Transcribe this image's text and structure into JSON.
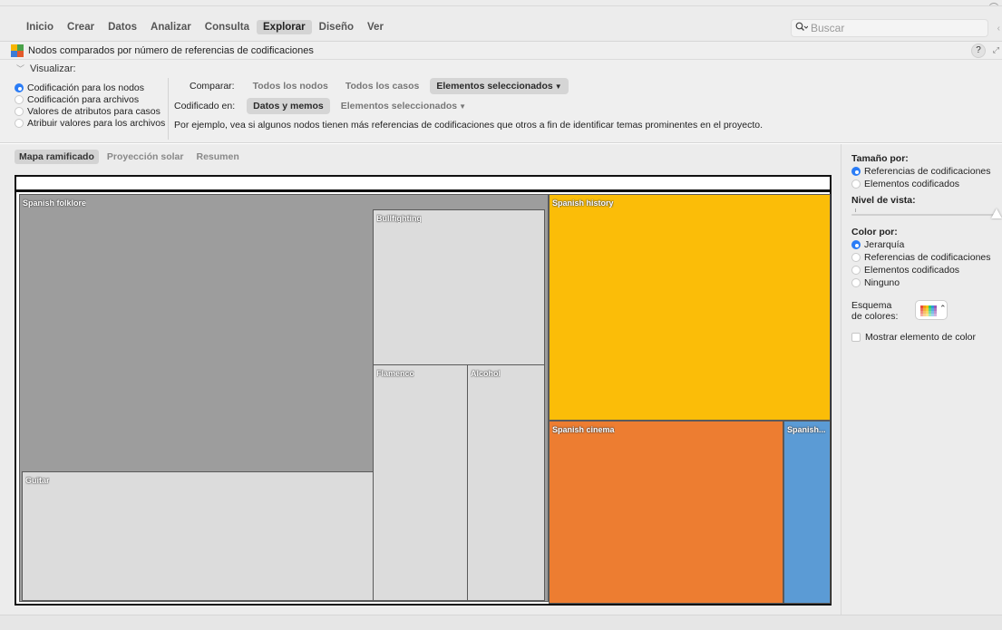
{
  "menu": {
    "items": [
      "Inicio",
      "Crear",
      "Datos",
      "Analizar",
      "Consulta",
      "Explorar",
      "Diseño",
      "Ver"
    ],
    "active_index": 5
  },
  "search": {
    "icon": "search-icon",
    "placeholder": "Buscar"
  },
  "title": {
    "text": "Nodos comparados por número de referencias de codificaciones",
    "help_label": "?"
  },
  "options": {
    "visualize_label": "Visualizar:",
    "visualize_options": [
      {
        "label": "Codificación para los nodos",
        "selected": true
      },
      {
        "label": "Codificación para archivos",
        "selected": false
      },
      {
        "label": "Valores de atributos para casos",
        "selected": false
      },
      {
        "label": "Atribuir valores para los archivos",
        "selected": false
      }
    ],
    "compare_label": "Comparar:",
    "compare_options": [
      "Todos los nodos",
      "Todos los casos",
      "Elementos seleccionados"
    ],
    "compare_selected": 2,
    "coded_label": "Codificado en:",
    "coded_options": [
      "Datos y memos",
      "Elementos seleccionados"
    ],
    "coded_selected": 0,
    "example_text": "Por ejemplo, vea si algunos nodos tienen más referencias de codificaciones que otros a fin de identificar temas prominentes en el proyecto."
  },
  "tabs": {
    "items": [
      "Mapa ramificado",
      "Proyección solar",
      "Resumen"
    ],
    "active_index": 0
  },
  "treemap": {
    "colors": {
      "spanish_folklore": "#9d9d9d",
      "children": "#dcdcdc",
      "spanish_history": "#fbbd08",
      "spanish_cinema": "#ed7d31",
      "spanish_other": "#5b9bd5"
    },
    "nodes": {
      "spanish_folklore": "Spanish folklore",
      "bullfighting": "Bullfighting",
      "flamenco": "Flamenco",
      "alcohol": "Alcohol",
      "guitar": "Guitar",
      "spanish_history": "Spanish history",
      "spanish_cinema": "Spanish cinema",
      "spanish_other": "Spanish..."
    }
  },
  "right_panel": {
    "size_by_label": "Tamaño por:",
    "size_by_options": [
      {
        "label": "Referencias de codificaciones",
        "selected": true
      },
      {
        "label": "Elementos codificados",
        "selected": false
      }
    ],
    "view_level_label": "Nivel de vista:",
    "view_level_value": 1.0,
    "color_by_label": "Color por:",
    "color_by_options": [
      {
        "label": "Jerarquía",
        "selected": true
      },
      {
        "label": "Referencias de codificaciones",
        "selected": false
      },
      {
        "label": "Elementos codificados",
        "selected": false
      },
      {
        "label": "Ninguno",
        "selected": false
      }
    ],
    "scheme_label_line1": "Esquema",
    "scheme_label_line2": "de colores:",
    "show_color_label": "Mostrar elemento de color"
  }
}
